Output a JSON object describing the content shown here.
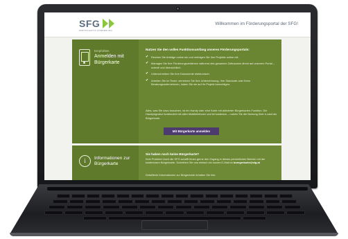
{
  "header": {
    "logo_text": "SFG",
    "logo_subtitle": "WIRTSCHAFTS FÖRDERUNG",
    "title": "Willkommen im Förderungsportal der SFG!"
  },
  "login_panel": {
    "kicker": "Empfohlen",
    "title": "Anmelden mit Bürgerkarte",
    "intro": "Nutzen Sie den vollen Funktionsumfang unseres Förderungsportals:",
    "benefits": [
      "Reichen Sie Anträge online ein und verfolgen Sie Ihre Projekte online mit.",
      "Managen Sie Ihre Förderungsverfahren während des gesamten Zeitraumes direkt auf unserem Portal – schnell und übersichtlich.",
      "Unterschreiben Sie Ihre Dokumente elektronisch.",
      "Arbeiten Sie im Team: vernetzen Sie Ihre Unternehmung, Ihre Standorte oder Ihren Beratungsunternehmen, indem Sie sie auf Ihr Projekt berechtigen."
    ],
    "note": "Alles, was Sie dazu brauchen, ist ein Handy oder eine Karte mit aktivierter Bürgerkarten-Funktion. Die Handysignatur funktioniert mit allen Mobiltelefonen und ist kostenlos – nutzen Sie die Nutzung Ihrer e-card als Bürgerkarte.",
    "button_label": "Mit Bürgerkarte anmelden"
  },
  "info_panel": {
    "title": "Informationen zur Bürgerkarte",
    "question": "Sie haben noch keine Bürgerkarte?",
    "text": "Kein Problem! Auch die SFG schafft Ihnen gerne den Zugang in dieses persönlichen Bereich mit der kostenlosen Bürgerkarte. Schreiben Sie uns einfach ein kurzes E-Mail an",
    "email": "buergerkarte@sfg.at",
    "more": "Detaillierte Informationen zur Bürgerkarte erhalten Sie hier."
  },
  "colors": {
    "brand_green": "#8cc63f",
    "panel_green": "#6b8633",
    "button_purple": "#4d3a6f"
  },
  "icons": [
    "mobile-phone-icon",
    "check-icon",
    "info-icon"
  ]
}
